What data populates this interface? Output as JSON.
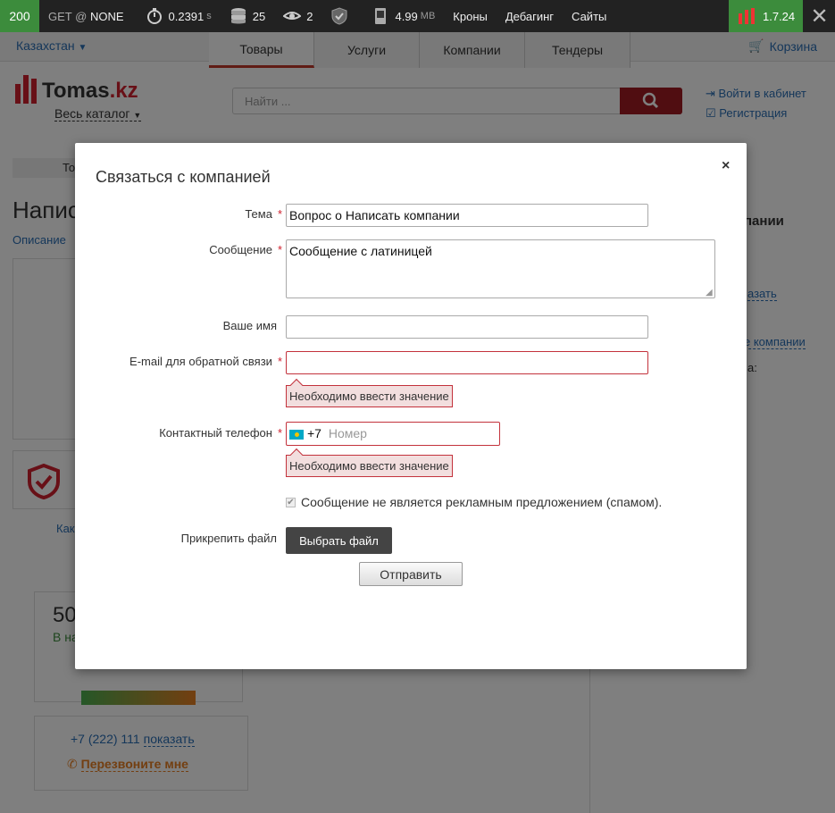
{
  "debug_toolbar": {
    "status": "200",
    "method_prefix": "GET @",
    "route": "NONE",
    "time_value": "0.2391",
    "time_unit": "s",
    "db_count": "25",
    "events_count": "2",
    "memory_value": "4.99",
    "memory_unit": "MB",
    "links": [
      "Кроны",
      "Дебагинг",
      "Сайты"
    ],
    "version": "1.7.24",
    "colors": {
      "status_bg": "#3c8c3c",
      "bar_bg": "#222222"
    }
  },
  "site": {
    "region": "Казахстан",
    "tabs": [
      "Товары",
      "Услуги",
      "Компании",
      "Тендеры"
    ],
    "cart": "Корзина",
    "logo_name": "Tomas",
    "logo_tld": ".kz",
    "catalog": "Весь каталог",
    "search_placeholder": "Найти ...",
    "login": "Войти в кабинет",
    "register": "Регистрация",
    "bg": {
      "breadcrumb": "То",
      "heading": "Напис",
      "tab_desc": "Описание",
      "side_title": "пании",
      "side_link1": "азать",
      "side_link2": "е компании",
      "side_label": "а:",
      "card_link": "Как",
      "price_partial": "50",
      "stock_partial": "В на",
      "phone": "+7 (222) 111",
      "phone_show": "показать",
      "callback": "Перезвоните мне"
    }
  },
  "modal": {
    "title": "Связаться с компанией",
    "close": "×",
    "required_mark": "*",
    "subject_label": "Тема",
    "subject_value": "Вопрос о Написать компании",
    "message_label": "Сообщение",
    "message_value": "Сообщение с латиницей",
    "name_label": "Ваше имя",
    "name_value": "",
    "email_label": "E-mail для обратной связи",
    "email_value": "",
    "email_error": "Необходимо ввести значение",
    "phone_label": "Контактный телефон",
    "phone_code": "+7",
    "phone_placeholder": "Номер",
    "phone_error": "Необходимо ввести значение",
    "spam_checkbox_label": "Сообщение не является рекламным предложением (спамом).",
    "spam_checked": true,
    "attach_label": "Прикрепить файл",
    "attach_button": "Выбрать файл",
    "submit_button": "Отправить"
  }
}
